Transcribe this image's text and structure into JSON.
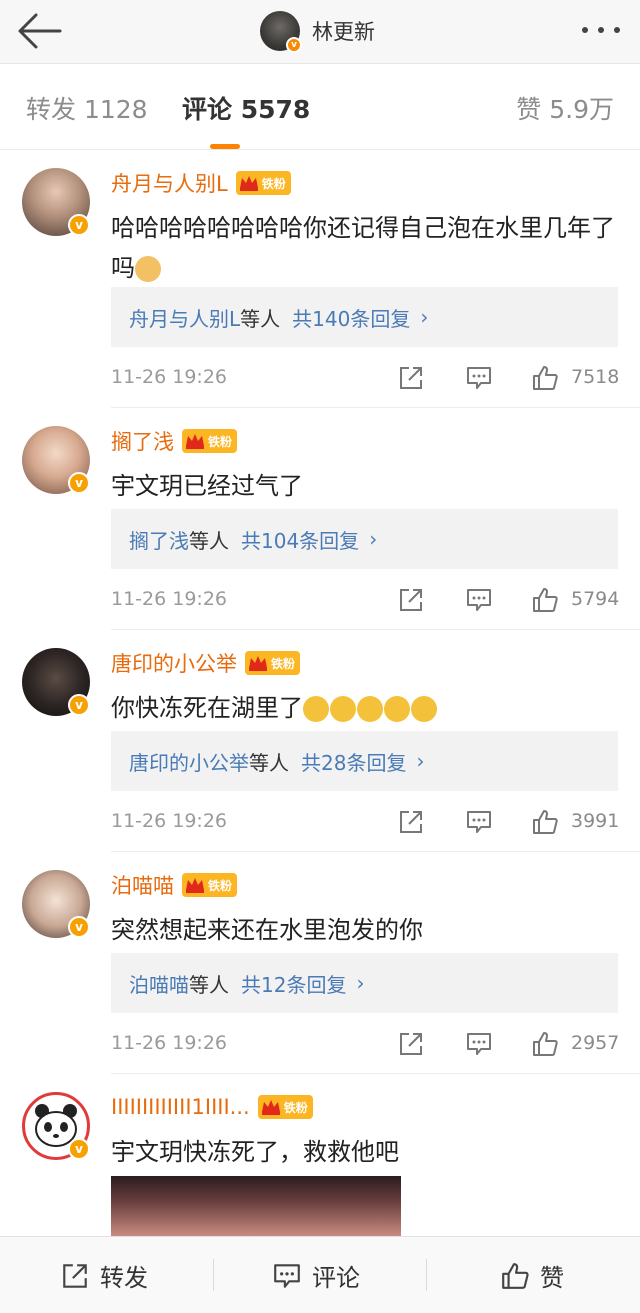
{
  "header": {
    "profile_name": "林更新",
    "back_icon": "arrow-left-icon",
    "more_icon": "more-dots-icon"
  },
  "tabs": {
    "forward": "转发 1128",
    "comments": "评论 5578",
    "likes": "赞 5.9万",
    "active_color": "#ff8200"
  },
  "comments": [
    {
      "user": "舟月与人别L",
      "badge": "铁粉",
      "text": "哈哈哈哈哈哈哈哈你还记得自己泡在水里几年了吗",
      "emoji": "doge-emoji",
      "replies_name": "舟月与人别L",
      "replies_suffix": "等人",
      "replies_count": "共140条回复",
      "chevron": "›",
      "time": "11-26 19:26",
      "likes": "7518"
    },
    {
      "user": "搁了浅",
      "badge": "铁粉",
      "text": "宇文玥已经过气了",
      "replies_name": "搁了浅",
      "replies_suffix": "等人",
      "replies_count": "共104条回复",
      "chevron": "›",
      "time": "11-26 19:26",
      "likes": "5794"
    },
    {
      "user": "唐印的小公举",
      "badge": "铁粉",
      "text": "你快冻死在湖里了",
      "emoji": "angry-emoji",
      "replies_name": "唐印的小公举",
      "replies_suffix": "等人",
      "replies_count": "共28条回复",
      "chevron": "›",
      "time": "11-26 19:26",
      "likes": "3991"
    },
    {
      "user": "泊喵喵",
      "badge": "铁粉",
      "text": "突然想起来还在水里泡发的你",
      "replies_name": "泊喵喵",
      "replies_suffix": "等人",
      "replies_count": "共12条回复",
      "chevron": "›",
      "time": "11-26 19:26",
      "likes": "2957"
    },
    {
      "user": "IIIIIIIIIIIII1IIII...",
      "badge": "铁粉",
      "text": "宇文玥快冻死了，救救他吧"
    }
  ],
  "bottom_bar": {
    "forward": "转发",
    "comment": "评论",
    "like": "赞"
  },
  "colors": {
    "username": "#e86b0e",
    "link": "#4a7bb6",
    "badge": "#fcb523"
  }
}
